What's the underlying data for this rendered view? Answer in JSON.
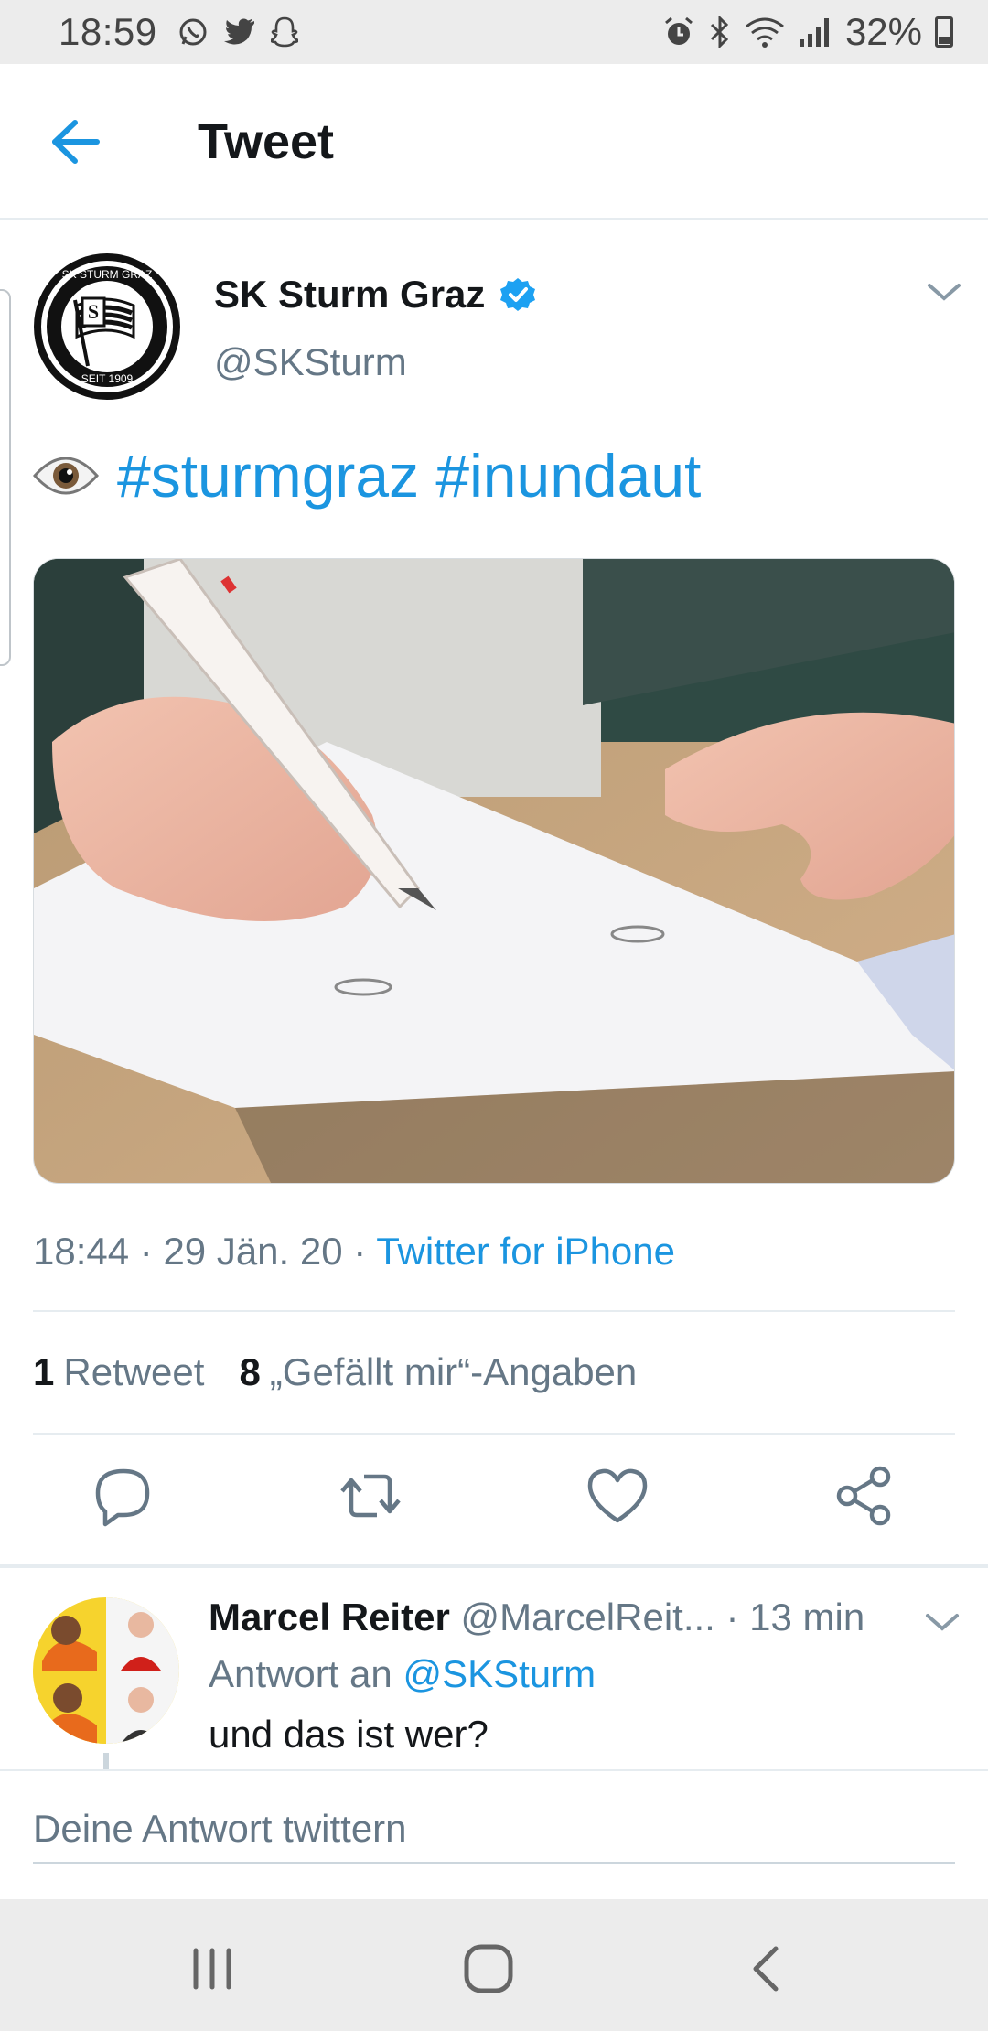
{
  "status_bar": {
    "time": "18:59",
    "left_icons": [
      "whatsapp-icon",
      "twitter-icon",
      "snapchat-icon"
    ],
    "right_icons": [
      "alarm-icon",
      "bluetooth-icon",
      "wifi-icon",
      "signal-icon"
    ],
    "battery": "32%"
  },
  "header": {
    "title": "Tweet",
    "back_icon": "arrow-left-icon"
  },
  "tweet": {
    "author_name": "SK Sturm Graz",
    "handle": "@SKSturm",
    "verified": true,
    "avatar_text_top": "SK STURM GRAZ",
    "avatar_text_bottom": "SEIT 1909",
    "text_emoji": "eye-emoji",
    "hashtags": "#sturmgraz #inundaut",
    "media_alt": "hand signing document with pen",
    "time": "18:44",
    "date": "29 Jän. 20",
    "source": "Twitter for iPhone",
    "retweet_count": "1",
    "retweet_label": "Retweet",
    "like_count": "8",
    "like_label": "„Gefällt mir“-Angaben"
  },
  "actions": [
    "reply-icon",
    "retweet-icon",
    "like-icon",
    "share-icon"
  ],
  "reply": {
    "name": "Marcel Reiter",
    "handle": "@MarcelReit...",
    "time": "· 13 min",
    "reply_to_label": "Antwort an",
    "reply_to_handle": "@SKSturm",
    "text": "und das ist wer?"
  },
  "compose": {
    "placeholder": "Deine Antwort twittern"
  },
  "navbar": [
    "recent-apps-icon",
    "home-icon",
    "back-icon"
  ],
  "colors": {
    "accent": "#1b95e0",
    "text_primary": "#14171a",
    "text_secondary": "#657786",
    "divider": "#e6ecf0"
  }
}
